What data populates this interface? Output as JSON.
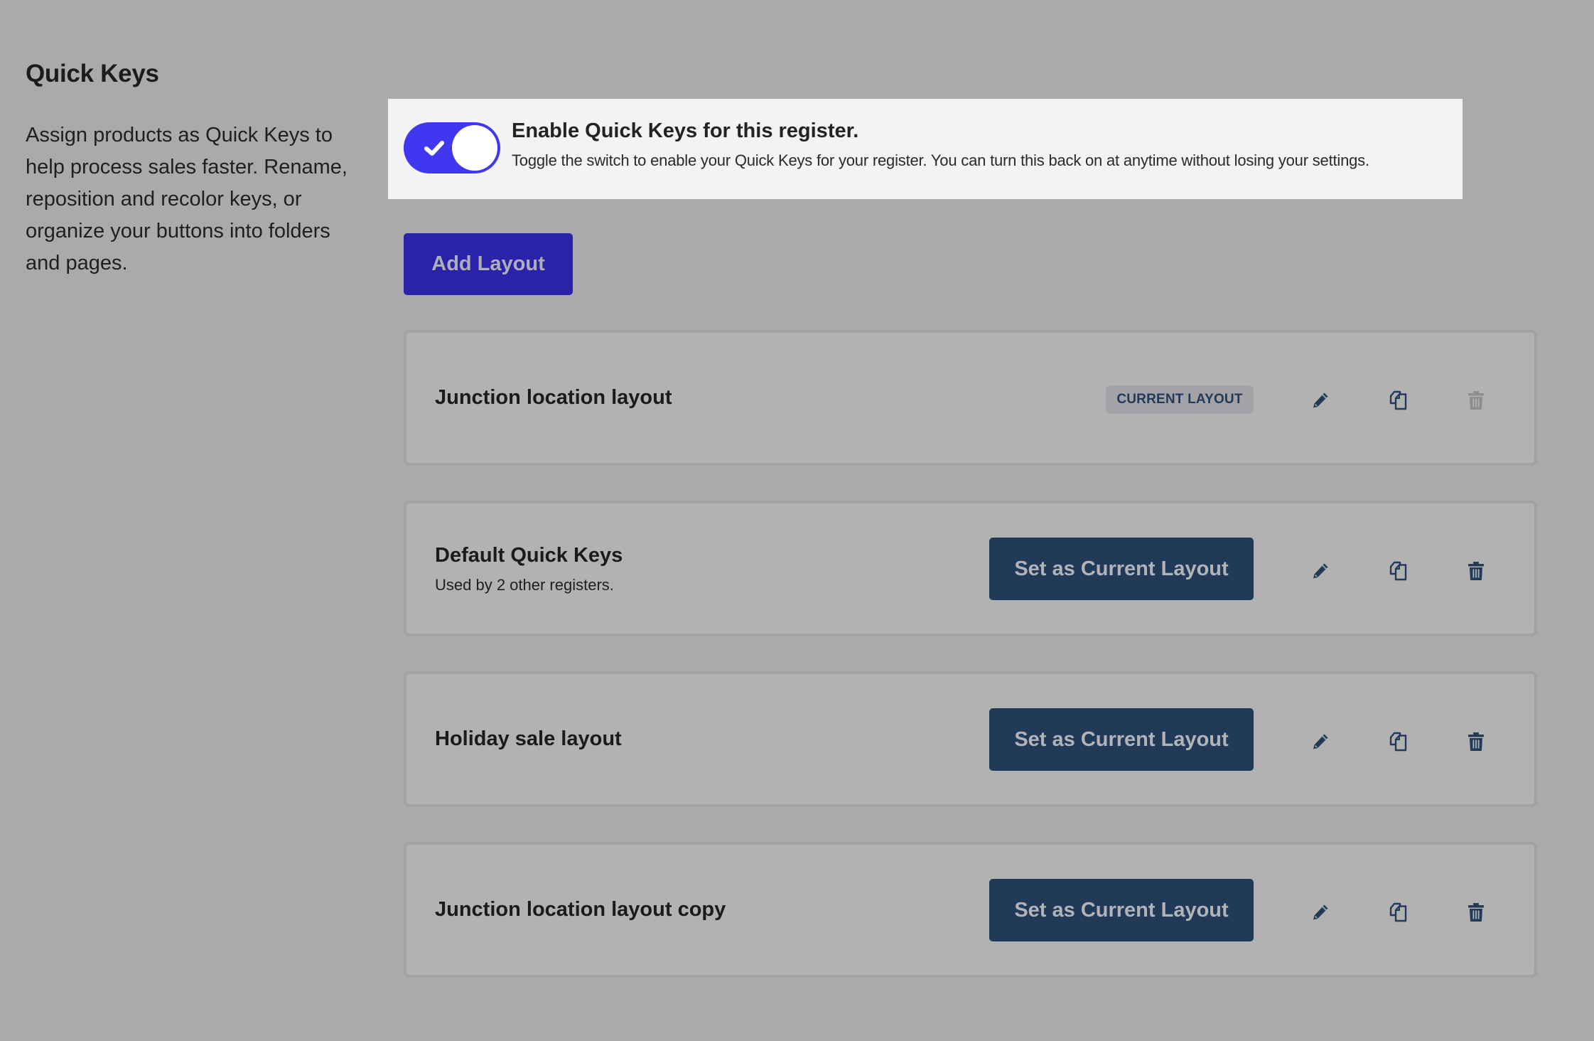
{
  "section": {
    "title": "Quick Keys",
    "description": "Assign products as Quick Keys to help process sales faster. Rename, reposition and recolor keys, or organize your buttons into folders and pages."
  },
  "notice": {
    "toggle_enabled": true,
    "toggle_icon": "check-icon",
    "title": "Enable Quick Keys for this register.",
    "description": "Toggle the switch to enable your Quick Keys for your register. You can turn this back on at anytime without losing your settings."
  },
  "toolbar": {
    "add_layout_label": "Add Layout"
  },
  "layouts": [
    {
      "name": "Junction location layout",
      "subtitle": null,
      "is_current": true,
      "badge_label": "CURRENT LAYOUT",
      "delete_enabled": false
    },
    {
      "name": "Default Quick Keys",
      "subtitle": "Used by 2 other registers.",
      "is_current": false,
      "action_label": "Set as Current Layout",
      "delete_enabled": true
    },
    {
      "name": "Holiday sale layout",
      "subtitle": null,
      "is_current": false,
      "action_label": "Set as Current Layout",
      "delete_enabled": true
    },
    {
      "name": "Junction location layout copy",
      "subtitle": null,
      "is_current": false,
      "action_label": "Set as Current Layout",
      "delete_enabled": true
    }
  ],
  "icons": {
    "edit": "pencil-icon",
    "duplicate": "copy-icon",
    "delete": "trash-icon"
  },
  "colors": {
    "background": "#aba9ac",
    "toggle_on": "#3f38f0",
    "primary_button": "#2a22a8",
    "secondary_button": "#213a58",
    "icon": "#213a58",
    "icon_disabled": "#8e8e90",
    "card_bg": "#b2b2b2",
    "notice_bg": "#f3f2f5"
  }
}
